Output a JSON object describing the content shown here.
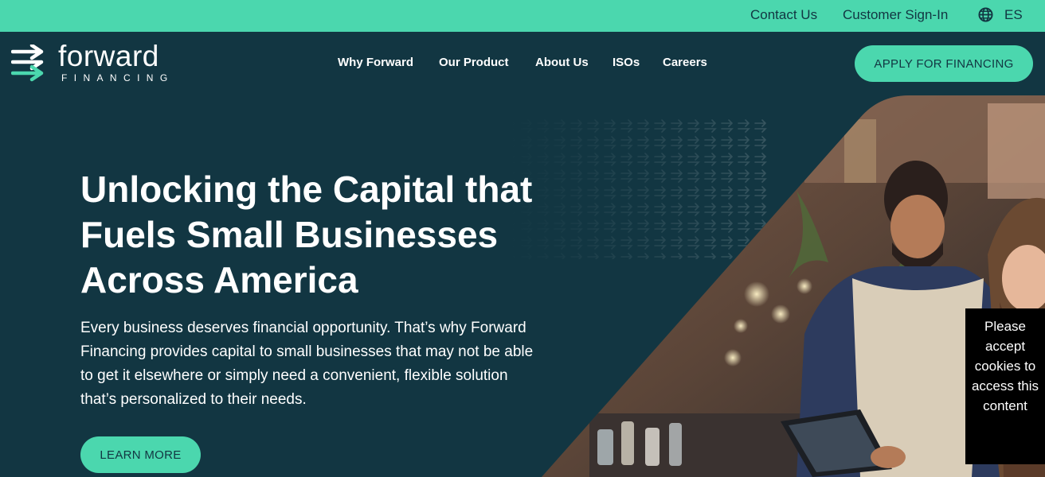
{
  "topbar": {
    "contact": "Contact Us",
    "signin": "Customer Sign-In",
    "language": "ES",
    "globe_icon": "globe-icon"
  },
  "brand": {
    "name": "forward",
    "sub": "FINANCING",
    "logo_icon": "double-arrow-logo-icon"
  },
  "nav": {
    "items": [
      "Why Forward",
      "Our Product",
      "About Us",
      "ISOs",
      "Careers"
    ]
  },
  "header": {
    "apply_label": "APPLY FOR FINANCING"
  },
  "hero": {
    "title": "Unlocking the Capital that Fuels Small Businesses Across America",
    "body": "Every business deserves financial opportunity. That’s why Forward Financing provides capital to small businesses that may not be able to get it elsewhere or simply need a convenient, flexible solution that’s personalized to their needs.",
    "cta_label": "LEARN MORE"
  },
  "cookie_notice": {
    "text": "Please accept cookies to access this content"
  },
  "colors": {
    "accent": "#4bd7ae",
    "navy": "#123642",
    "white": "#ffffff"
  }
}
